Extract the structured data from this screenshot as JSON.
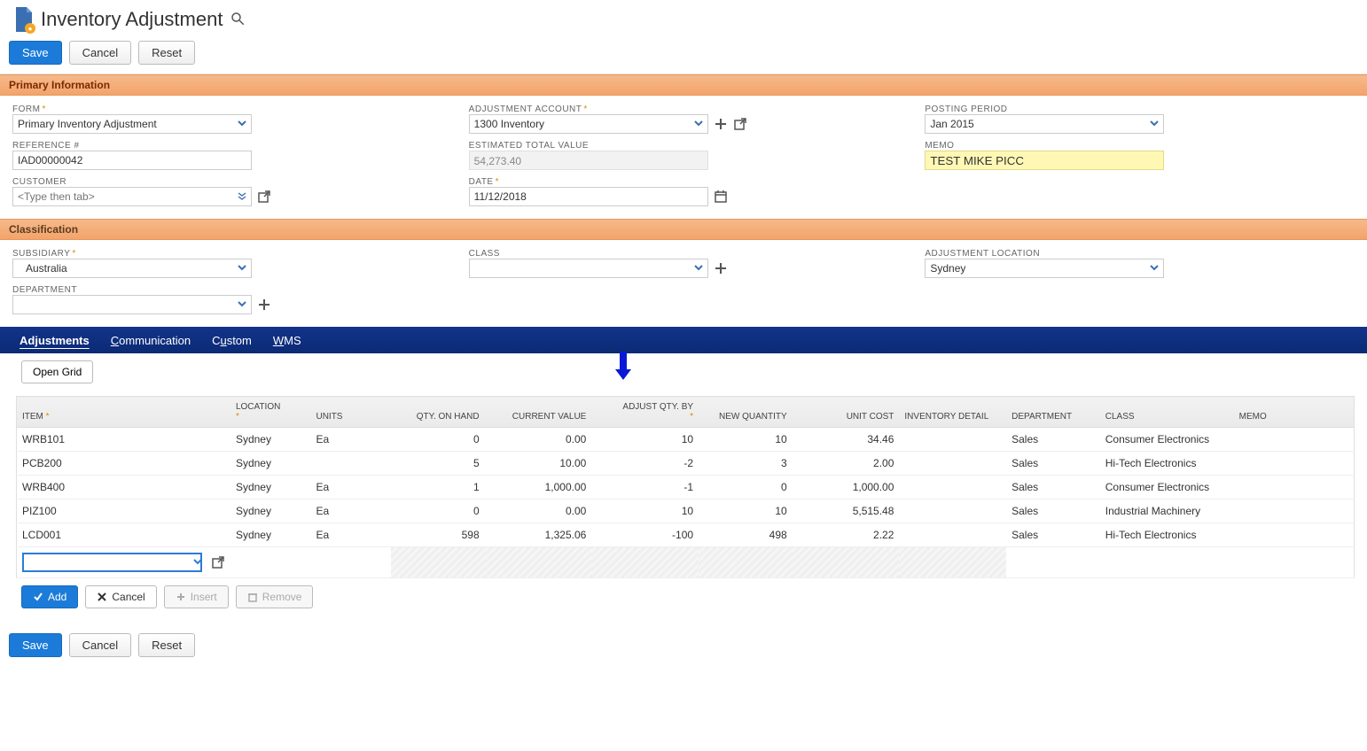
{
  "header": {
    "title": "Inventory Adjustment"
  },
  "actions": {
    "save": "Save",
    "cancel": "Cancel",
    "reset": "Reset"
  },
  "sections": {
    "primary": "Primary Information",
    "classification": "Classification"
  },
  "labels": {
    "form": "FORM",
    "reference": "REFERENCE #",
    "customer": "CUSTOMER",
    "adjustment_account": "ADJUSTMENT ACCOUNT",
    "estimated_total_value": "ESTIMATED TOTAL VALUE",
    "date": "DATE",
    "posting_period": "POSTING PERIOD",
    "memo": "MEMO",
    "subsidiary": "SUBSIDIARY",
    "department": "DEPARTMENT",
    "class": "CLASS",
    "adjustment_location": "ADJUSTMENT LOCATION"
  },
  "values": {
    "form": "Primary Inventory Adjustment",
    "reference": "IAD00000042",
    "customer_placeholder": "<Type then tab>",
    "adjustment_account": "1300 Inventory",
    "estimated_total_value": "54,273.40",
    "date": "11/12/2018",
    "posting_period": "Jan 2015",
    "memo": "TEST MIKE PICC",
    "subsidiary": "Australia",
    "department": "",
    "class": "",
    "adjustment_location": "Sydney"
  },
  "tabs": [
    "Adjustments",
    "Communication",
    "Custom",
    "WMS"
  ],
  "grid": {
    "open_grid": "Open Grid",
    "columns": {
      "item": "ITEM",
      "location": "LOCATION",
      "units": "UNITS",
      "qty_on_hand": "QTY. ON HAND",
      "current_value": "CURRENT VALUE",
      "adjust_qty_by": "ADJUST QTY. BY",
      "new_quantity": "NEW QUANTITY",
      "unit_cost": "UNIT COST",
      "inventory_detail": "INVENTORY DETAIL",
      "department": "DEPARTMENT",
      "class": "CLASS",
      "memo": "MEMO"
    },
    "rows": [
      {
        "item": "WRB101",
        "location": "Sydney",
        "units": "Ea",
        "qty_on_hand": "0",
        "current_value": "0.00",
        "adjust_by": "10",
        "new_qty": "10",
        "unit_cost": "34.46",
        "inv_detail": "",
        "dept": "Sales",
        "class": "Consumer Electronics",
        "memo": ""
      },
      {
        "item": "PCB200",
        "location": "Sydney",
        "units": "",
        "qty_on_hand": "5",
        "current_value": "10.00",
        "adjust_by": "-2",
        "new_qty": "3",
        "unit_cost": "2.00",
        "inv_detail": "",
        "dept": "Sales",
        "class": "Hi-Tech Electronics",
        "memo": ""
      },
      {
        "item": "WRB400",
        "location": "Sydney",
        "units": "Ea",
        "qty_on_hand": "1",
        "current_value": "1,000.00",
        "adjust_by": "-1",
        "new_qty": "0",
        "unit_cost": "1,000.00",
        "inv_detail": "",
        "dept": "Sales",
        "class": "Consumer Electronics",
        "memo": ""
      },
      {
        "item": "PIZ100",
        "location": "Sydney",
        "units": "Ea",
        "qty_on_hand": "0",
        "current_value": "0.00",
        "adjust_by": "10",
        "new_qty": "10",
        "unit_cost": "5,515.48",
        "inv_detail": "",
        "dept": "Sales",
        "class": "Industrial Machinery",
        "memo": ""
      },
      {
        "item": "LCD001",
        "location": "Sydney",
        "units": "Ea",
        "qty_on_hand": "598",
        "current_value": "1,325.06",
        "adjust_by": "-100",
        "new_qty": "498",
        "unit_cost": "2.22",
        "inv_detail": "",
        "dept": "Sales",
        "class": "Hi-Tech Electronics",
        "memo": ""
      }
    ],
    "actions": {
      "add": "Add",
      "cancel": "Cancel",
      "insert": "Insert",
      "remove": "Remove"
    }
  }
}
